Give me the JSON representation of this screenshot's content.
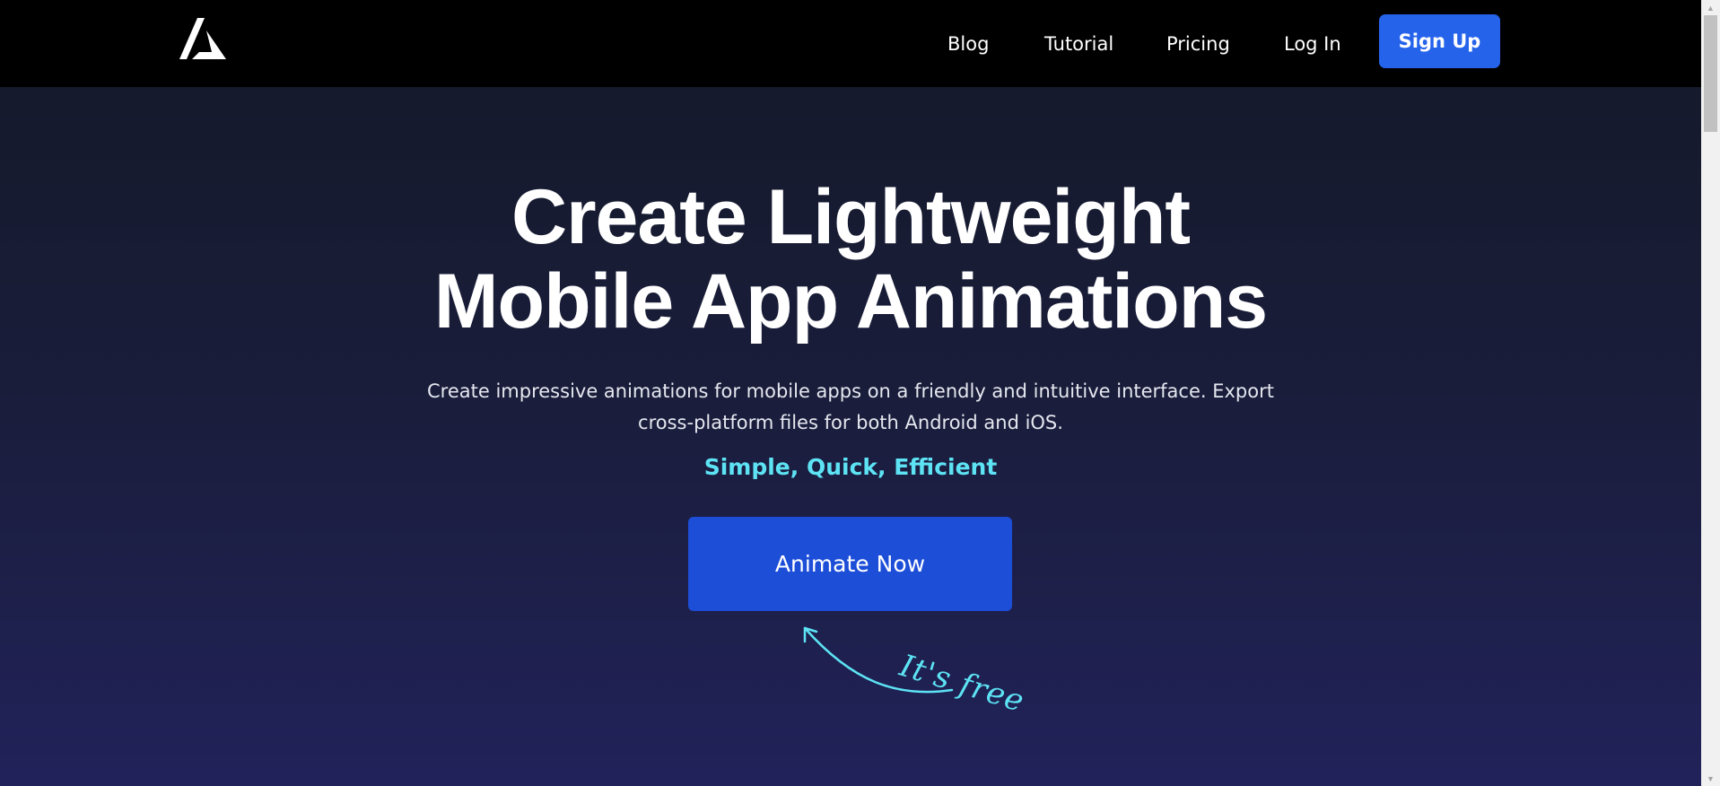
{
  "header": {
    "logo_icon": "arrow-a-logo-icon",
    "nav": {
      "blog": "Blog",
      "tutorial": "Tutorial",
      "pricing": "Pricing",
      "login": "Log In",
      "signup": "Sign Up"
    }
  },
  "hero": {
    "title_line1": "Create Lightweight",
    "title_line2": "Mobile App Animations",
    "subtitle_line1": "Create impressive animations for mobile apps on a friendly and intuitive interface. Export",
    "subtitle_line2": "cross-platform files for both Android and iOS.",
    "tagline": "Simple, Quick, Efficient",
    "cta_label": "Animate Now",
    "free_note": "It's free"
  },
  "colors": {
    "nav_bg": "#000000",
    "primary_button": "#2563eb",
    "cta_button": "#1d4ed8",
    "accent": "#5de3f4",
    "hero_bg_top": "#151a2c",
    "hero_bg_bottom": "#21225a"
  },
  "scrollbar": {
    "up_icon": "scroll-up-arrow-icon",
    "down_icon": "scroll-down-arrow-icon"
  }
}
